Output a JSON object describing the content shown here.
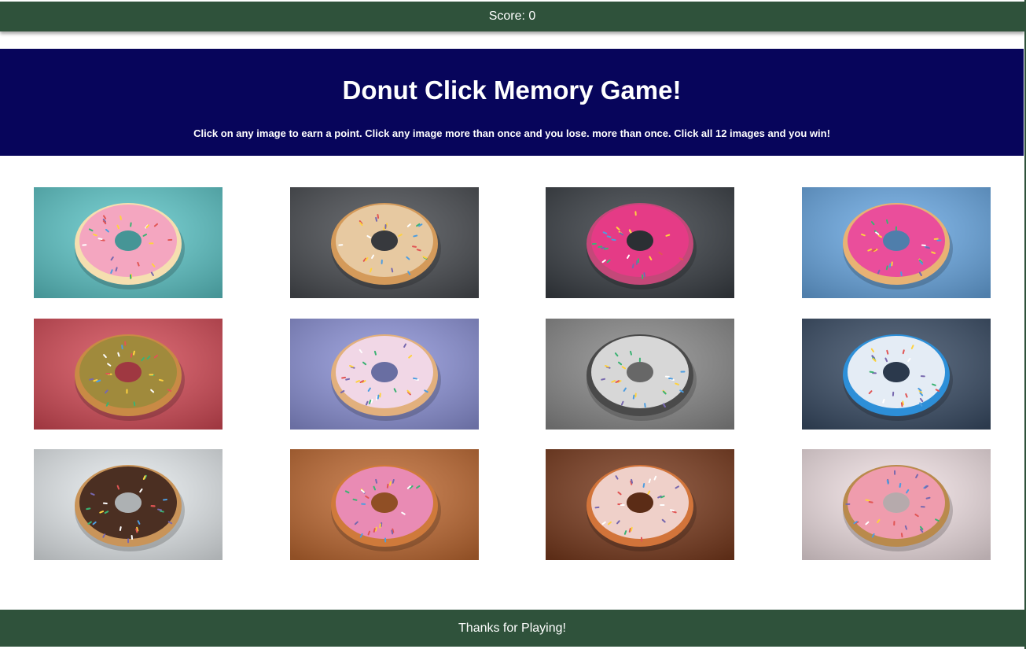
{
  "navbar": {
    "score_label": "Score: 0"
  },
  "header": {
    "title": "Donut Click Memory Game!",
    "instructions": "Click on any image to earn a point. Click any image more than once and you lose. more than once. Click all 12 images and you win!"
  },
  "footer": {
    "text": "Thanks for Playing!"
  },
  "colors": {
    "navbar": "#2f523b",
    "header": "#07055b",
    "footer": "#2f523b"
  },
  "cards": [
    {
      "name": "donut-card-pink-bitten-teal",
      "bg": "#5ec7c9",
      "icing": "#f4a6c0",
      "dough": "#f5dfb0"
    },
    {
      "name": "donut-card-hands-sprinkles",
      "bg": "#4a4d52",
      "icing": "#e7c9a1",
      "dough": "#d49a5a"
    },
    {
      "name": "donut-card-pink-sprinkles-dark",
      "bg": "#3a3f45",
      "icing": "#e53b86",
      "dough": "#c44879"
    },
    {
      "name": "donut-card-pink-blue-background",
      "bg": "#6aa9e4",
      "icing": "#ea4e9b",
      "dough": "#e8b274"
    },
    {
      "name": "donut-card-red-checkered",
      "bg": "#d54b57",
      "icing": "#a08a3c",
      "dough": "#c98a45"
    },
    {
      "name": "donut-card-stacked-lavender",
      "bg": "#8d93d8",
      "icing": "#f1d7e6",
      "dough": "#e2b07d"
    },
    {
      "name": "donut-card-black-white-plate",
      "bg": "#8a8a8a",
      "icing": "#d7d7d7",
      "dough": "#4a4a4a"
    },
    {
      "name": "donut-card-blue-sprinkles",
      "bg": "#3a4d66",
      "icing": "#e4ecf5",
      "dough": "#2d8fd8"
    },
    {
      "name": "donut-card-chocolate-drizzle",
      "bg": "#e7ecef",
      "icing": "#4b2f22",
      "dough": "#c99459"
    },
    {
      "name": "donut-card-rainbow-closeup",
      "bg": "#c06a32",
      "icing": "#e98bb4",
      "dough": "#cf7a3b"
    },
    {
      "name": "donut-card-sprinkle-eggs",
      "bg": "#7a3b1e",
      "icing": "#efd0c9",
      "dough": "#d2743a"
    },
    {
      "name": "donut-card-pink-cruller",
      "bg": "#f3e3e6",
      "icing": "#ef9cad",
      "dough": "#b98a4c"
    }
  ]
}
